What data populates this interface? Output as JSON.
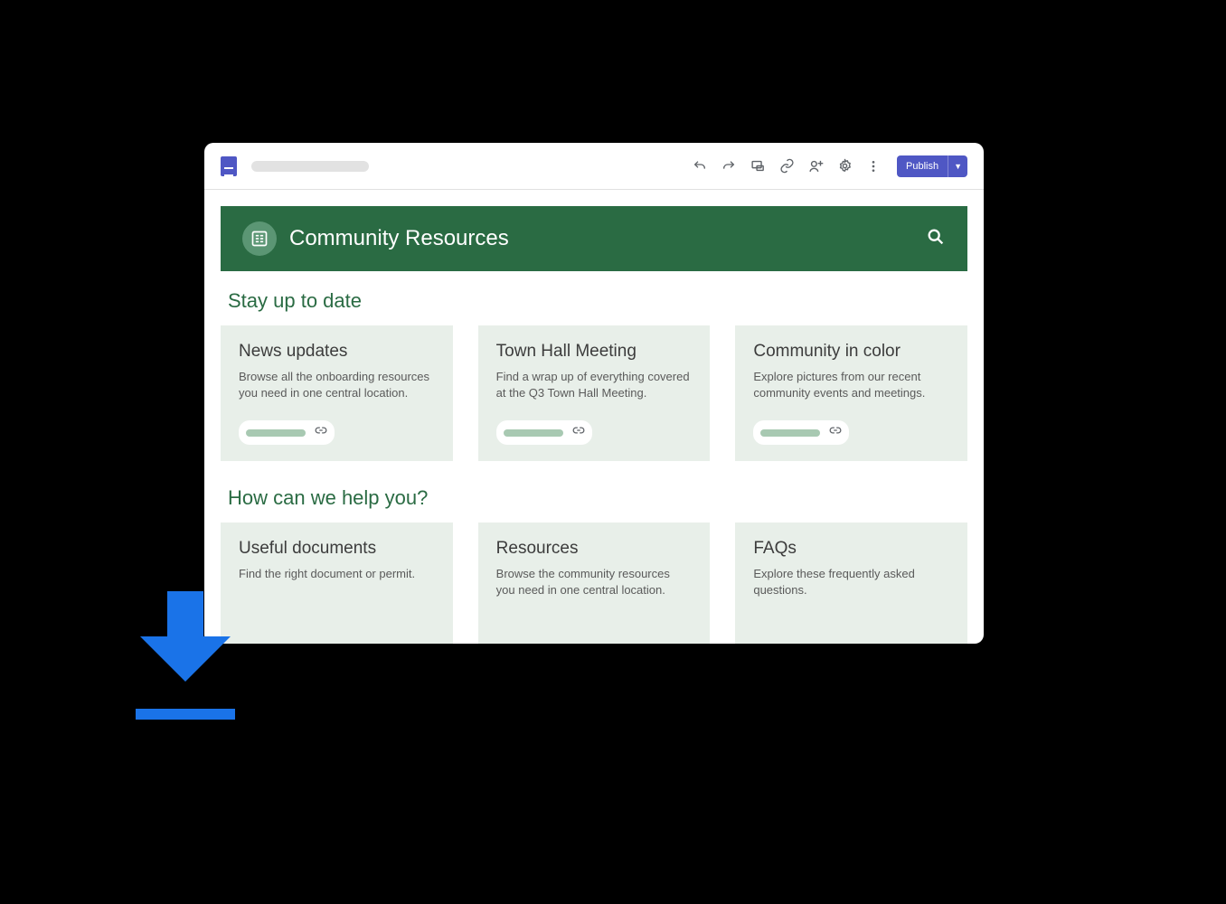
{
  "toolbar": {
    "publish_label": "Publish"
  },
  "site": {
    "title": "Community Resources"
  },
  "sections": {
    "row1": {
      "heading": "Stay up to date",
      "cards": [
        {
          "title": "News updates",
          "desc": "Browse all the onboarding resources you need in one central location."
        },
        {
          "title": "Town Hall Meeting",
          "desc": "Find a wrap up of everything covered at the Q3 Town Hall Meeting."
        },
        {
          "title": "Community in color",
          "desc": "Explore pictures from our recent community events and meetings."
        }
      ]
    },
    "row2": {
      "heading": "How can we help you?",
      "cards": [
        {
          "title": "Useful documents",
          "desc": "Find the right document or permit."
        },
        {
          "title": "Resources",
          "desc": "Browse the community resources you need in one central location."
        },
        {
          "title": "FAQs",
          "desc": "Explore these frequently asked questions."
        }
      ]
    }
  }
}
